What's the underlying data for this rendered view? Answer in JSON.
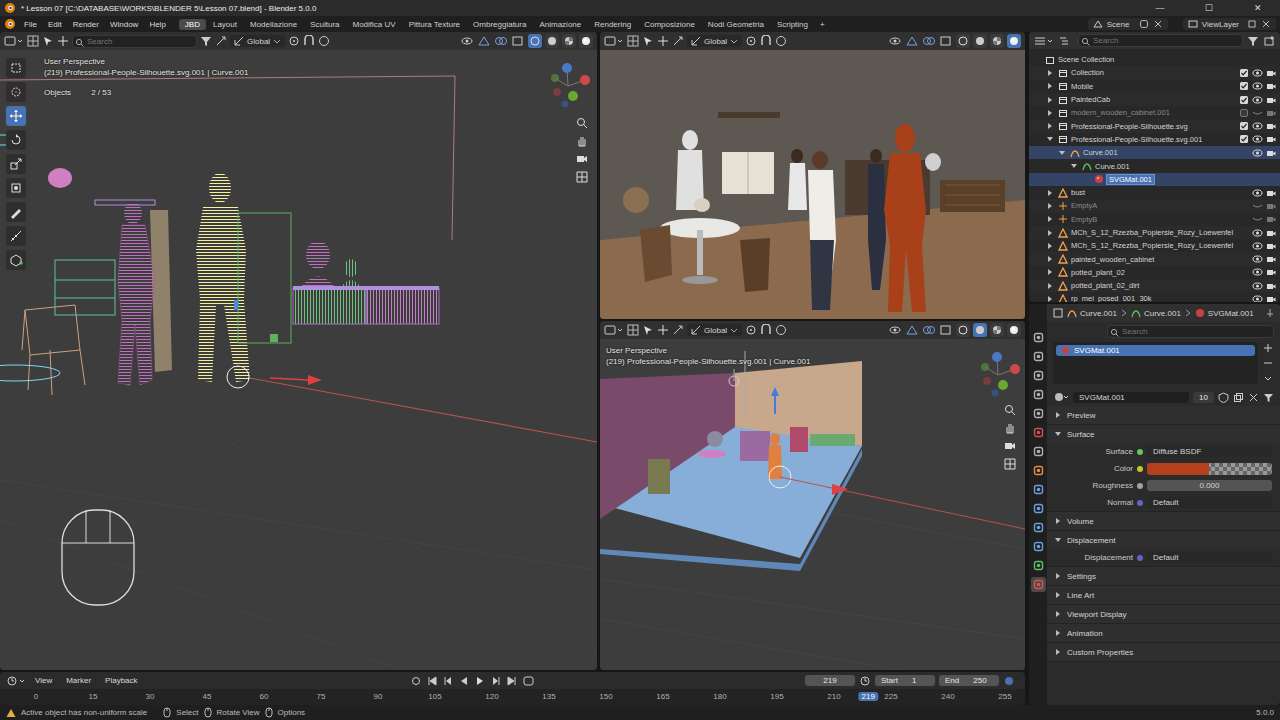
{
  "window": {
    "title": "* Lesson 07 [C:\\DATABASE\\WORKS\\BLENDER 5\\Lesson 07.blend] - Blender 5.0.0",
    "controls": [
      "—",
      "☐",
      "✕"
    ]
  },
  "menu": [
    "File",
    "Edit",
    "Render",
    "Window",
    "Help"
  ],
  "workspaces": [
    {
      "label": "JBD",
      "selected": true
    },
    {
      "label": "Layout",
      "selected": false
    },
    {
      "label": "Modellazione",
      "selected": false
    },
    {
      "label": "Scultura",
      "selected": false
    },
    {
      "label": "Modifica UV",
      "selected": false
    },
    {
      "label": "Pittura Texture",
      "selected": false
    },
    {
      "label": "Ombreggiatura",
      "selected": false
    },
    {
      "label": "Animazione",
      "selected": false
    },
    {
      "label": "Rendering",
      "selected": false
    },
    {
      "label": "Composizione",
      "selected": false
    },
    {
      "label": "Nodi Geometria",
      "selected": false
    },
    {
      "label": "Scripting",
      "selected": false
    }
  ],
  "workspace_add": "+",
  "scene": {
    "label": "Scene"
  },
  "view_layer": {
    "label": "ViewLayer"
  },
  "viewport_main": {
    "search": {
      "placeholder": "Search"
    },
    "orientation": "Global",
    "view": "User Perspective",
    "context": "(219) Professional-People-Silhouette.svg.001 | Curve.001",
    "objects_label": "Objects",
    "objects_count": "2 / 53",
    "shading": [
      {
        "selected": true
      },
      {
        "selected": false
      },
      {
        "selected": false
      },
      {
        "selected": false
      }
    ],
    "tools": [
      {
        "selected": false
      },
      {
        "selected": false
      },
      {
        "selected": true
      },
      {
        "selected": false
      },
      {
        "selected": false
      },
      {
        "selected": false
      },
      {
        "selected": false
      },
      {
        "selected": false
      },
      {
        "selected": false
      }
    ]
  },
  "viewport_render": {
    "orientation": "Global",
    "shading": [
      {
        "selected": false
      },
      {
        "selected": false
      },
      {
        "selected": false
      },
      {
        "selected": true
      }
    ]
  },
  "viewport_solid": {
    "orientation": "Global",
    "view": "User Perspective",
    "context": "(219) Professional-People-Silhouette.svg.001 | Curve.001",
    "shading": [
      {
        "selected": false
      },
      {
        "selected": true
      },
      {
        "selected": false
      },
      {
        "selected": false
      }
    ]
  },
  "outliner": {
    "search": {
      "placeholder": "Search"
    },
    "root": "Scene Collection",
    "items": [
      {
        "label": "Collection",
        "depth": 0,
        "kind": "collection",
        "expanded": false,
        "selected": false,
        "active": false,
        "dimmed": false,
        "checked": true,
        "visible": true
      },
      {
        "label": "Mobile",
        "depth": 0,
        "kind": "collection",
        "expanded": false,
        "selected": false,
        "active": false,
        "dimmed": false,
        "checked": true,
        "visible": true
      },
      {
        "label": "PaintedCab",
        "depth": 0,
        "kind": "collection",
        "expanded": false,
        "selected": false,
        "active": false,
        "dimmed": false,
        "checked": true,
        "visible": true
      },
      {
        "label": "modern_wooden_cabinet.001",
        "depth": 0,
        "kind": "collection",
        "expanded": false,
        "selected": false,
        "active": false,
        "dimmed": true,
        "checked": false,
        "visible": false
      },
      {
        "label": "Professional-People-Silhouette.svg",
        "depth": 0,
        "kind": "collection",
        "expanded": false,
        "selected": false,
        "active": false,
        "dimmed": false,
        "checked": true,
        "visible": true
      },
      {
        "label": "Professional-People-Silhouette.svg.001",
        "depth": 0,
        "kind": "collection",
        "expanded": true,
        "selected": false,
        "active": false,
        "dimmed": false,
        "checked": true,
        "visible": true
      },
      {
        "label": "Curve.001",
        "depth": 1,
        "kind": "curve",
        "expanded": true,
        "selected": true,
        "active": false,
        "dimmed": false,
        "visible": true
      },
      {
        "label": "Curve.001",
        "depth": 2,
        "kind": "curve_data",
        "expanded": true,
        "selected": false,
        "active": false,
        "dimmed": false
      },
      {
        "label": "SVGMat.001",
        "depth": 3,
        "kind": "material",
        "expanded": false,
        "selected": true,
        "active": true,
        "dimmed": false
      },
      {
        "label": "bust",
        "depth": 0,
        "kind": "mesh",
        "expanded": false,
        "selected": false,
        "active": false,
        "dimmed": false,
        "visible": true
      },
      {
        "label": "EmptyA",
        "depth": 0,
        "kind": "empty",
        "expanded": false,
        "selected": false,
        "active": false,
        "dimmed": true,
        "visible": false
      },
      {
        "label": "EmptyB",
        "depth": 0,
        "kind": "empty",
        "expanded": false,
        "selected": false,
        "active": false,
        "dimmed": true,
        "visible": false
      },
      {
        "label": "MCh_S_12_Rzezba_Popiersie_Rozy_Loewenfel",
        "depth": 0,
        "kind": "mesh",
        "expanded": false,
        "selected": false,
        "active": false,
        "dimmed": false,
        "visible": true
      },
      {
        "label": "MCh_S_12_Rzezba_Popiersie_Rozy_Loewenfel",
        "depth": 0,
        "kind": "mesh",
        "expanded": false,
        "selected": false,
        "active": false,
        "dimmed": false,
        "visible": true
      },
      {
        "label": "painted_wooden_cabinet",
        "depth": 0,
        "kind": "mesh",
        "expanded": false,
        "selected": false,
        "active": false,
        "dimmed": false,
        "visible": true
      },
      {
        "label": "potted_plant_02",
        "depth": 0,
        "kind": "mesh",
        "expanded": false,
        "selected": false,
        "active": false,
        "dimmed": false,
        "visible": true
      },
      {
        "label": "potted_plant_02_dirt",
        "depth": 0,
        "kind": "mesh",
        "expanded": false,
        "selected": false,
        "active": false,
        "dimmed": false,
        "visible": true
      },
      {
        "label": "rp_mei_posed_001_30k",
        "depth": 0,
        "kind": "mesh",
        "expanded": false,
        "selected": false,
        "active": false,
        "dimmed": false,
        "visible": true
      }
    ]
  },
  "properties": {
    "tabs": [
      {
        "selected": false,
        "color": "#b0b0b0"
      },
      {
        "selected": false,
        "color": "#b0b0b0"
      },
      {
        "selected": false,
        "color": "#b0b0b0"
      },
      {
        "selected": false,
        "color": "#b0b0b0"
      },
      {
        "selected": false,
        "color": "#b0b0b0"
      },
      {
        "selected": false,
        "color": "#d05050"
      },
      {
        "selected": false,
        "color": "#b0b0b0"
      },
      {
        "selected": false,
        "color": "#e09040"
      },
      {
        "selected": false,
        "color": "#6aa0e0"
      },
      {
        "selected": false,
        "color": "#6aa0e0"
      },
      {
        "selected": false,
        "color": "#6aa0e0"
      },
      {
        "selected": false,
        "color": "#6aa0e0"
      },
      {
        "selected": false,
        "color": "#60c060"
      },
      {
        "selected": true,
        "color": "#e05050"
      }
    ],
    "breadcrumb": [
      "Curve.001",
      "Curve.001",
      "SVGMat.001"
    ],
    "search": {
      "placeholder": "Search"
    },
    "slots": [
      {
        "label": "SVGMat.001",
        "selected": true
      }
    ],
    "material": {
      "name": "SVGMat.001",
      "users": "10"
    },
    "panels": [
      {
        "label": "Preview",
        "expanded": false,
        "rows": []
      },
      {
        "label": "Surface",
        "expanded": true,
        "rows": [
          {
            "label": "Surface",
            "kind": "field",
            "value": "Diffuse BSDF",
            "color": "#63c763"
          },
          {
            "label": "Color",
            "kind": "color",
            "swatch": "#b5401e",
            "color": "#c7c729"
          },
          {
            "label": "Roughness",
            "kind": "number",
            "value": "0.000",
            "color": "#a1a1a1"
          },
          {
            "label": "Normal",
            "kind": "field",
            "value": "Default",
            "color": "#6363c7"
          }
        ]
      },
      {
        "label": "Volume",
        "expanded": false,
        "rows": []
      },
      {
        "label": "Displacement",
        "expanded": true,
        "rows": [
          {
            "label": "Displacement",
            "kind": "field",
            "value": "Default",
            "color": "#6363c7"
          }
        ]
      },
      {
        "label": "Settings",
        "expanded": false,
        "rows": []
      },
      {
        "label": "Line Art",
        "expanded": false,
        "rows": []
      },
      {
        "label": "Viewport Display",
        "expanded": false,
        "rows": []
      },
      {
        "label": "Animation",
        "expanded": false,
        "rows": []
      },
      {
        "label": "Custom Properties",
        "expanded": false,
        "rows": []
      }
    ]
  },
  "timeline": {
    "menu": [
      "View",
      "Marker",
      "Playback"
    ],
    "current": "219",
    "start_label": "Start",
    "start": "1",
    "end_label": "End",
    "end": "250",
    "ruler": [
      {
        "label": "0",
        "selected": false
      },
      {
        "label": "15",
        "selected": false
      },
      {
        "label": "30",
        "selected": false
      },
      {
        "label": "45",
        "selected": false
      },
      {
        "label": "60",
        "selected": false
      },
      {
        "label": "75",
        "selected": false
      },
      {
        "label": "90",
        "selected": false
      },
      {
        "label": "105",
        "selected": false
      },
      {
        "label": "120",
        "selected": false
      },
      {
        "label": "135",
        "selected": false
      },
      {
        "label": "150",
        "selected": false
      },
      {
        "label": "165",
        "selected": false
      },
      {
        "label": "180",
        "selected": false
      },
      {
        "label": "195",
        "selected": false
      },
      {
        "label": "210",
        "selected": false
      },
      {
        "label": "219",
        "selected": true
      },
      {
        "label": "225",
        "selected": false
      },
      {
        "label": "240",
        "selected": false
      },
      {
        "label": "255",
        "selected": false
      }
    ]
  },
  "status_bar": {
    "message": "Active object has non-uniform scale",
    "hints": [
      "Select",
      "Rotate View",
      "Options"
    ],
    "version": "5.0.0"
  }
}
